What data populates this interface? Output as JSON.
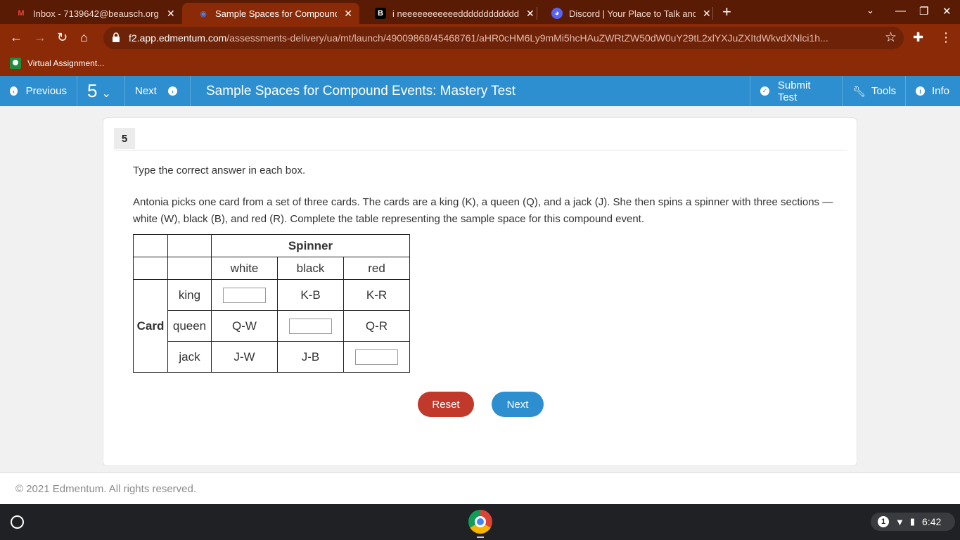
{
  "browser": {
    "tabs": [
      {
        "title": "Inbox - 7139642@beausch.org - B",
        "icon": "gmail-icon"
      },
      {
        "title": "Sample Spaces for Compound Ev",
        "icon": "edmentum-icon",
        "active": true
      },
      {
        "title": "i neeeeeeeeeeeddddddddddddd",
        "icon": "brainly-icon"
      },
      {
        "title": "Discord | Your Place to Talk and H",
        "icon": "discord-icon"
      }
    ],
    "url_host": "f2.app.edmentum.com",
    "url_path": "/assessments-delivery/ua/mt/launch/49009868/45468761/aHR0cHM6Ly9mMi5hcHAuZWRtZW50dW0uY29tL2xlYXJuZXItdWkvdXNlci1h...",
    "bookmark": "Virtual Assignment..."
  },
  "appbar": {
    "previous": "Previous",
    "question_number": "5",
    "next": "Next",
    "title": "Sample Spaces for Compound Events: Mastery Test",
    "submit": "Submit Test",
    "tools": "Tools",
    "info": "Info"
  },
  "question": {
    "number": "5",
    "instruction": "Type the correct answer in each box.",
    "prompt": "Antonia picks one card from a set of three cards. The cards are a king (K), a queen (Q), and a jack (J). She then spins a spinner with three sections —white (W), black (B), and red (R). Complete the table representing the sample space for this compound event."
  },
  "table": {
    "spinner_header": "Spinner",
    "card_header": "Card",
    "columns": [
      "white",
      "black",
      "red"
    ],
    "rows": [
      {
        "label": "king",
        "cells": [
          "",
          "K-B",
          "K-R"
        ]
      },
      {
        "label": "queen",
        "cells": [
          "Q-W",
          "",
          "Q-R"
        ]
      },
      {
        "label": "jack",
        "cells": [
          "J-W",
          "J-B",
          ""
        ]
      }
    ]
  },
  "buttons": {
    "reset": "Reset",
    "next": "Next"
  },
  "footer": "© 2021 Edmentum. All rights reserved.",
  "shelf": {
    "notification_count": "1",
    "time": "6:42"
  },
  "colors": {
    "frame": "#8a2a07",
    "appbar": "#2d8fcf",
    "reset": "#c0392b"
  }
}
